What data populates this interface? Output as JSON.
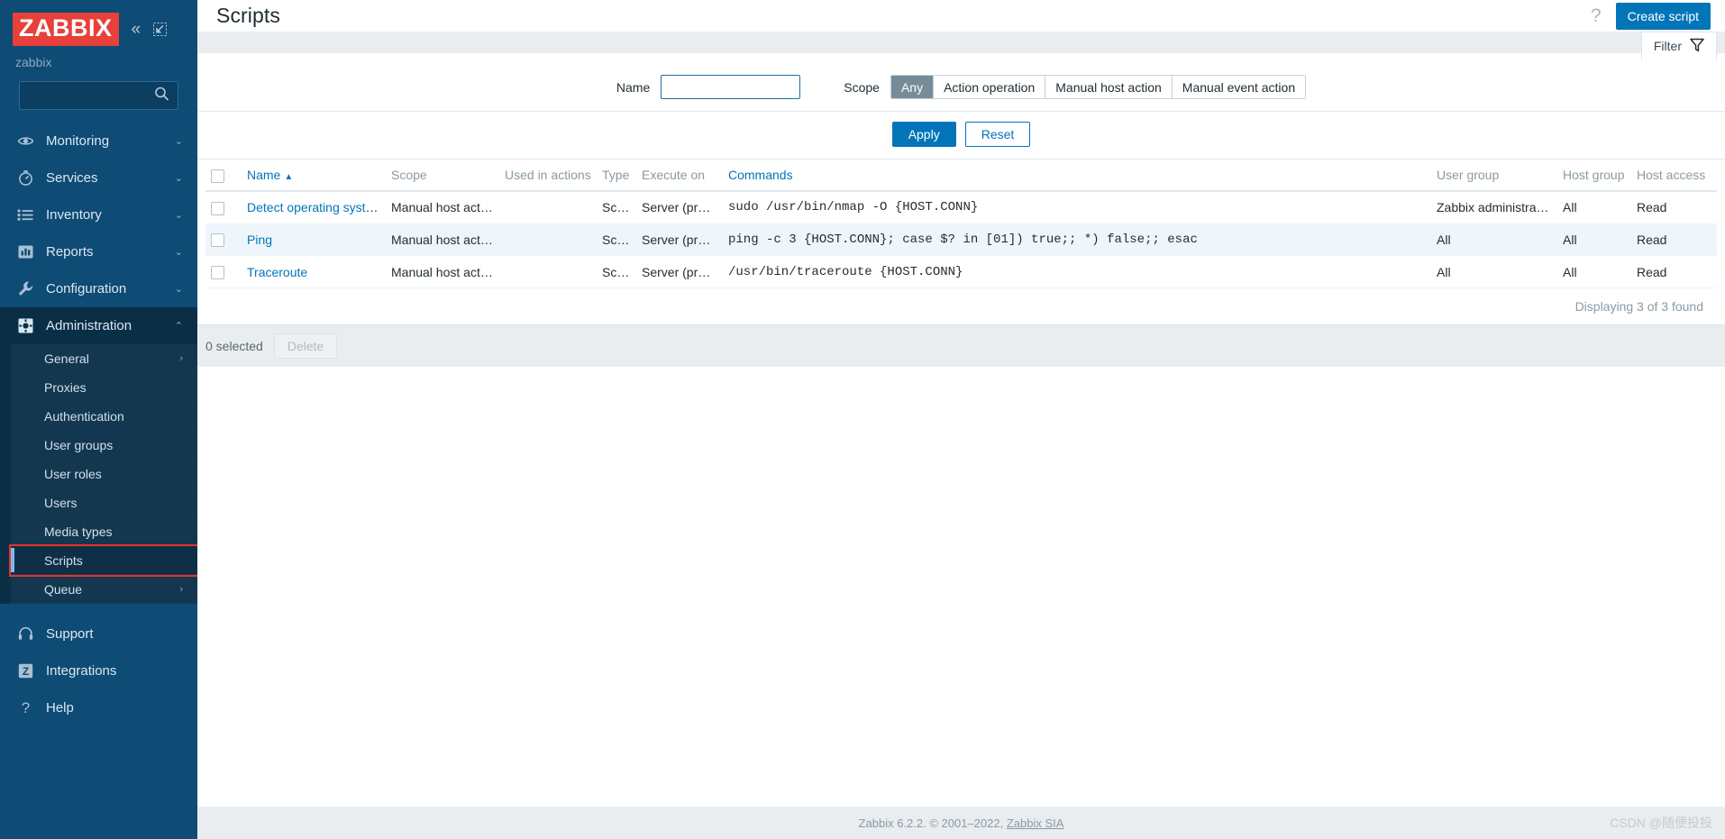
{
  "sidebar": {
    "logo_text": "ZABBIX",
    "collapse_icon": "collapse-chevrons-icon",
    "expand_icon": "expand-view-icon",
    "server_name": "zabbix",
    "search_placeholder": "",
    "search_value": "",
    "nav": [
      {
        "label": "Monitoring",
        "icon": "eye-icon",
        "chevron": "⌄"
      },
      {
        "label": "Services",
        "icon": "clock-icon",
        "chevron": "⌄"
      },
      {
        "label": "Inventory",
        "icon": "list-icon",
        "chevron": "⌄"
      },
      {
        "label": "Reports",
        "icon": "chart-icon",
        "chevron": "⌄"
      },
      {
        "label": "Configuration",
        "icon": "wrench-icon",
        "chevron": "⌄"
      },
      {
        "label": "Administration",
        "icon": "gear-icon",
        "chevron": "⌃"
      }
    ],
    "submenu": [
      {
        "label": "General",
        "chevron": "›"
      },
      {
        "label": "Proxies",
        "chevron": ""
      },
      {
        "label": "Authentication",
        "chevron": ""
      },
      {
        "label": "User groups",
        "chevron": ""
      },
      {
        "label": "User roles",
        "chevron": ""
      },
      {
        "label": "Users",
        "chevron": ""
      },
      {
        "label": "Media types",
        "chevron": ""
      },
      {
        "label": "Scripts",
        "chevron": ""
      },
      {
        "label": "Queue",
        "chevron": "›"
      }
    ],
    "bottom_nav": [
      {
        "label": "Support",
        "icon": "headset-icon"
      },
      {
        "label": "Integrations",
        "icon": "zabbix-z-icon"
      },
      {
        "label": "Help",
        "icon": "question-mark-icon"
      }
    ]
  },
  "header": {
    "title": "Scripts",
    "help_icon": "question-mark-icon",
    "create_button": "Create script"
  },
  "filter": {
    "tab_label": "Filter",
    "tab_icon": "funnel-icon",
    "name_label": "Name",
    "name_value": "",
    "name_placeholder": "",
    "scope_label": "Scope",
    "scope_options": [
      "Any",
      "Action operation",
      "Manual host action",
      "Manual event action"
    ],
    "scope_selected": "Any",
    "apply_label": "Apply",
    "reset_label": "Reset"
  },
  "table": {
    "columns": [
      "Name",
      "Scope",
      "Used in actions",
      "Type",
      "Execute on",
      "Commands",
      "User group",
      "Host group",
      "Host access"
    ],
    "sort_column": "Name",
    "sort_indicator": "▲",
    "rows": [
      {
        "name": "Detect operating system",
        "scope": "Manual host action",
        "used_in_actions": "",
        "type": "Script",
        "execute_on": "Server (proxy)",
        "command": "sudo /usr/bin/nmap -O {HOST.CONN}",
        "user_group": "Zabbix administrators",
        "host_group": "All",
        "host_access": "Read"
      },
      {
        "name": "Ping",
        "scope": "Manual host action",
        "used_in_actions": "",
        "type": "Script",
        "execute_on": "Server (proxy)",
        "command": "ping -c 3 {HOST.CONN}; case $? in [01]) true;; *) false;; esac",
        "user_group": "All",
        "host_group": "All",
        "host_access": "Read"
      },
      {
        "name": "Traceroute",
        "scope": "Manual host action",
        "used_in_actions": "",
        "type": "Script",
        "execute_on": "Server (proxy)",
        "command": "/usr/bin/traceroute {HOST.CONN}",
        "user_group": "All",
        "host_group": "All",
        "host_access": "Read"
      }
    ],
    "displaying": "Displaying 3 of 3 found",
    "selected_count": "0 selected",
    "delete_label": "Delete"
  },
  "footer": {
    "text": "Zabbix 6.2.2. © 2001–2022, ",
    "link": "Zabbix SIA",
    "watermark": "CSDN @随便投投"
  },
  "colors": {
    "brand_red": "#e8403a",
    "sidebar_bg": "#0e4b75",
    "accent_blue": "#0275b8",
    "annotation_red": "#e8312b",
    "selected_bar": "#76bdf0"
  }
}
